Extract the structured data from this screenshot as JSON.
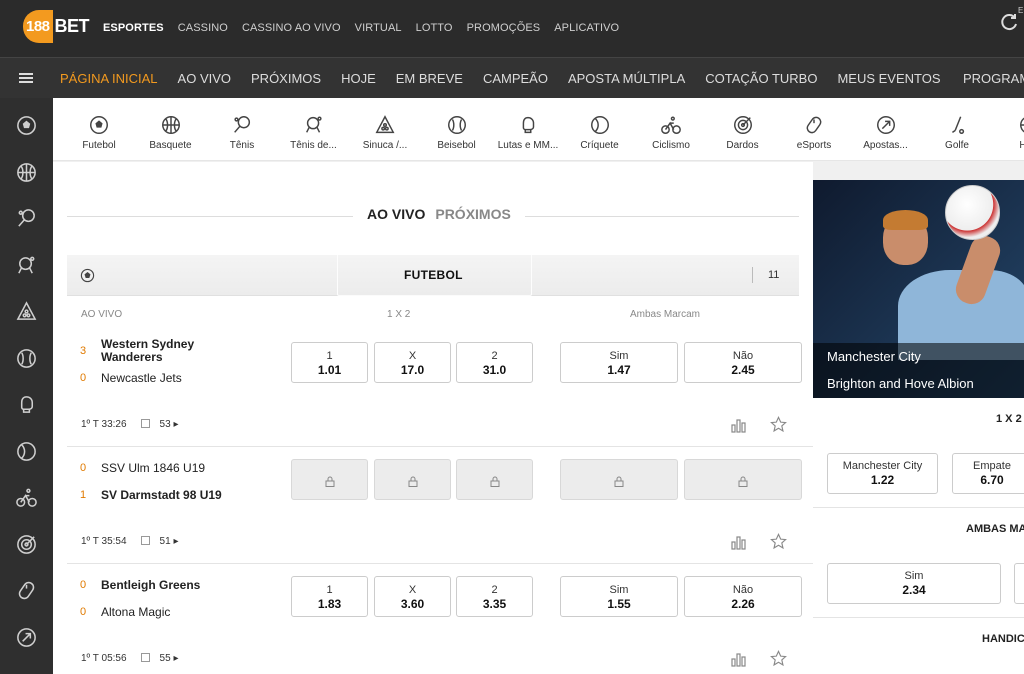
{
  "brand": {
    "num": "188",
    "bet": "BET"
  },
  "top_nav": [
    "ESPORTES",
    "CASSINO",
    "CASSINO AO VIVO",
    "VIRTUAL",
    "LOTTO",
    "PROMOÇÕES",
    "APLICATIVO"
  ],
  "top_nav_active": "ESPORTES",
  "top_right_text": "E",
  "sub_nav": [
    "PÁGINA INICIAL",
    "AO VIVO",
    "PRÓXIMOS",
    "HOJE",
    "EM BREVE",
    "CAMPEÃO",
    "APOSTA MÚLTIPLA",
    "COTAÇÃO TURBO",
    "MEUS EVENTOS"
  ],
  "sub_nav_active": "PÁGINA INICIAL",
  "sub_nav_right": "PROGRAM",
  "sidebar_icons": [
    "soccer-icon",
    "basketball-icon",
    "tennis-icon",
    "table-tennis-icon",
    "snooker-icon",
    "baseball-icon",
    "boxing-icon",
    "cricket-icon",
    "cycling-icon",
    "darts-icon",
    "esports-icon",
    "bets-icon"
  ],
  "sports": [
    {
      "label": "Futebol",
      "icon": "soccer-icon"
    },
    {
      "label": "Basquete",
      "icon": "basketball-icon"
    },
    {
      "label": "Tênis",
      "icon": "tennis-icon"
    },
    {
      "label": "Tênis de...",
      "icon": "table-tennis-icon"
    },
    {
      "label": "Sinuca /...",
      "icon": "snooker-icon"
    },
    {
      "label": "Beisebol",
      "icon": "baseball-icon"
    },
    {
      "label": "Lutas e MM...",
      "icon": "boxing-icon"
    },
    {
      "label": "Críquete",
      "icon": "cricket-icon"
    },
    {
      "label": "Ciclismo",
      "icon": "cycling-icon"
    },
    {
      "label": "Dardos",
      "icon": "darts-icon"
    },
    {
      "label": "eSports",
      "icon": "esports-icon"
    },
    {
      "label": "Apostas...",
      "icon": "bets-icon"
    },
    {
      "label": "Golfe",
      "icon": "golf-icon"
    },
    {
      "label": "Han",
      "icon": "handball-icon"
    }
  ],
  "tabs": {
    "live": "AO VIVO",
    "upcoming": "PRÓXIMOS"
  },
  "section": {
    "title": "FUTEBOL",
    "count": "11"
  },
  "headers": {
    "live": "AO VIVO",
    "market1": "1 X 2",
    "market2": "Ambas Marcam"
  },
  "matches": [
    {
      "home": {
        "score": "3",
        "name": "Western Sydney Wanderers",
        "bold": true
      },
      "away": {
        "score": "0",
        "name": "Newcastle Jets",
        "bold": false
      },
      "odds_1x2": [
        {
          "label": "1",
          "value": "1.01"
        },
        {
          "label": "X",
          "value": "17.0"
        },
        {
          "label": "2",
          "value": "31.0"
        }
      ],
      "odds_btts": [
        {
          "label": "Sim",
          "value": "1.47"
        },
        {
          "label": "Não",
          "value": "2.45"
        }
      ],
      "locked": false,
      "time": "1º T 33:26",
      "markets": "53"
    },
    {
      "home": {
        "score": "0",
        "name": "SSV Ulm 1846 U19",
        "bold": false
      },
      "away": {
        "score": "1",
        "name": "SV Darmstadt 98 U19",
        "bold": true
      },
      "odds_1x2": [],
      "odds_btts": [],
      "locked": true,
      "time": "1º T 35:54",
      "markets": "51"
    },
    {
      "home": {
        "score": "0",
        "name": "Bentleigh Greens",
        "bold": true
      },
      "away": {
        "score": "0",
        "name": "Altona Magic",
        "bold": false
      },
      "odds_1x2": [
        {
          "label": "1",
          "value": "1.83"
        },
        {
          "label": "X",
          "value": "3.60"
        },
        {
          "label": "2",
          "value": "3.35"
        }
      ],
      "odds_btts": [
        {
          "label": "Sim",
          "value": "1.55"
        },
        {
          "label": "Não",
          "value": "2.26"
        }
      ],
      "locked": false,
      "time": "1º T 05:56",
      "markets": "55"
    }
  ],
  "featured": {
    "home": "Manchester City",
    "away": "Brighton and Hove Albion",
    "market1_label": "1 X 2",
    "market1": [
      {
        "label": "Manchester City",
        "value": "1.22"
      },
      {
        "label": "Empate",
        "value": "6.70"
      }
    ],
    "market2_label": "AMBAS MAR",
    "market2": [
      {
        "label": "Sim",
        "value": "2.34"
      }
    ],
    "market3_label": "HANDICA"
  },
  "colors": {
    "accent": "#f39a1f",
    "topbar": "#2b2b2b",
    "score": "#e07a00"
  }
}
